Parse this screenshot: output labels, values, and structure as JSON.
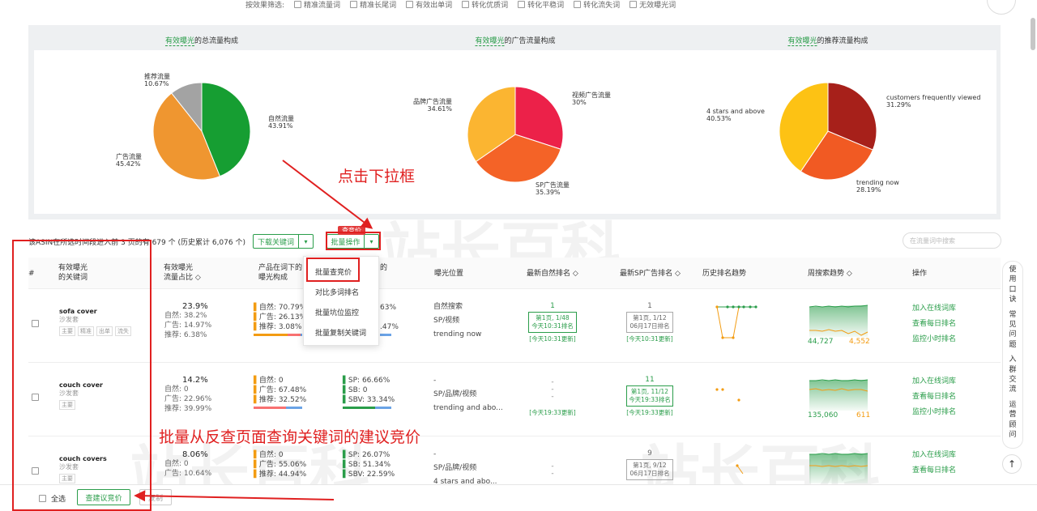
{
  "filters": {
    "prefix": "按效果筛选:",
    "options": [
      "精准流量词",
      "精准长尾词",
      "有效出单词",
      "转化优质词",
      "转化平稳词",
      "转化流失词",
      "无效曝光词"
    ]
  },
  "charts": [
    {
      "title_hl": "有效曝光",
      "title_rest": "的总流量构成",
      "slices": [
        {
          "label": "自然流量",
          "pct": "43.91%",
          "value": 43.91,
          "color": "#169e32"
        },
        {
          "label": "广告流量",
          "pct": "45.42%",
          "value": 45.42,
          "color": "#ef9630"
        },
        {
          "label": "推荐流量",
          "pct": "10.67%",
          "value": 10.67,
          "color": "#a3a3a3"
        }
      ]
    },
    {
      "title_hl": "有效曝光",
      "title_rest": "的广告流量构成",
      "slices": [
        {
          "label": "视频广告流量",
          "pct": "30%",
          "value": 30,
          "color": "#ec2149"
        },
        {
          "label": "SP广告流量",
          "pct": "35.39%",
          "value": 35.39,
          "color": "#f46327"
        },
        {
          "label": "品牌广告流量",
          "pct": "34.61%",
          "value": 34.61,
          "color": "#fbb531"
        }
      ]
    },
    {
      "title_hl": "有效曝光",
      "title_rest": "的推荐流量构成",
      "slices": [
        {
          "label": "customers frequently viewed",
          "pct": "31.29%",
          "value": 31.29,
          "color": "#a7201a"
        },
        {
          "label": "trending now",
          "pct": "28.19%",
          "value": 28.19,
          "color": "#f15a23"
        },
        {
          "label": "4 stars and above",
          "pct": "40.53%",
          "value": 40.53,
          "color": "#fdc214"
        }
      ]
    }
  ],
  "annotations": {
    "click_dropdown": "点击下拉框",
    "batch_query": "批量从反查页面查询关键词的建议竞价",
    "bid_badge": "查竞价"
  },
  "toolbar": {
    "summary": "该ASIN在所选时间段进入前 3 页的有 679 个 (历史累计 6,076 个)",
    "download_btn": "下载关键词",
    "batch_btn": "批量操作",
    "caret": "▾",
    "search_placeholder": "在流量词中搜索"
  },
  "dropdown": {
    "items": [
      "批量查竞价",
      "对比多词排名",
      "批量坑位监控",
      "批量复制关键词"
    ]
  },
  "table": {
    "headers": {
      "hash": "#",
      "keyword_1": "有效曝光",
      "keyword_2": "的关键词",
      "share_1": "有效曝光",
      "share_2": "流量占比 ◇",
      "mix_1": "产品在词下的",
      "mix_2": "曝光构成",
      "mix_right": "的",
      "position": "曝光位置",
      "natural_rank": "最新自然排名 ◇",
      "sp_rank": "最新SP广告排名 ◇",
      "history": "历史排名趋势",
      "weekly": "周搜索趋势 ◇",
      "ops": "操作"
    },
    "rows": [
      {
        "keyword": "sofa cover",
        "category": "沙发套",
        "tags": [
          "主要",
          "精准",
          "出单",
          "流失"
        ],
        "share": "23.9%",
        "natural": "自然: 38.2%",
        "ad": "广告: 14.97%",
        "rec": "推荐: 6.38%",
        "mix_natural": "自然: 70.79%",
        "mix_ad": "广告: 26.13%",
        "mix_rec": "推荐: 3.08%",
        "ad_sp": "63%",
        "ad_sb": "",
        "ad_sbv": ".47%",
        "positions": [
          "自然搜索",
          "SP/视频",
          "trending now"
        ],
        "nat_rank_num": "1",
        "nat_rank_box_1": "第1页, 1/48",
        "nat_rank_box_2": "今天10:31排名",
        "nat_rank_upd": "[今天10:31更新]",
        "sp_rank_num": "1",
        "sp_rank_box_1": "第1页, 1/12",
        "sp_rank_box_2": "06月17日排名",
        "sp_rank_upd": "[今天10:31更新]",
        "trend_left": "44,727",
        "trend_right": "4,552",
        "ops": [
          "加入在线词库",
          "查看每日排名",
          "监控小时排名"
        ]
      },
      {
        "keyword": "couch cover",
        "category": "沙发套",
        "tags": [
          "主要"
        ],
        "share": "14.2%",
        "natural": "自然: 0",
        "ad": "广告: 22.96%",
        "rec": "推荐: 39.99%",
        "mix_natural": "自然: 0",
        "mix_ad": "广告: 67.48%",
        "mix_rec": "推荐: 32.52%",
        "ad_sp": "SP: 66.66%",
        "ad_sb": "SB: 0",
        "ad_sbv": "SBV: 33.34%",
        "positions": [
          "-",
          "SP/品牌/视频",
          "trending and abo..."
        ],
        "nat_rank_num": "-",
        "nat_rank_upd": "[今天19:33更新]",
        "sp_rank_num": "11",
        "sp_rank_box_1": "第1页, 11/12",
        "sp_rank_box_2": "今天19:33排名",
        "sp_rank_upd": "[今天19:33更新]",
        "trend_left": "135,060",
        "trend_right": "611",
        "ops": [
          "加入在线词库",
          "查看每日排名",
          "监控小时排名"
        ]
      },
      {
        "keyword": "couch covers",
        "category": "沙发套",
        "tags": [
          "主要"
        ],
        "share": "8.06%",
        "natural": "自然: 0",
        "ad": "广告: 10.64%",
        "rec": "",
        "mix_natural": "自然: 0",
        "mix_ad": "广告: 55.06%",
        "mix_rec": "推荐: 44.94%",
        "ad_sp": "SP: 26.07%",
        "ad_sb": "SB: 51.34%",
        "ad_sbv": "SBV: 22.59%",
        "positions": [
          "-",
          "SP/品牌/视频",
          "4 stars and abo..."
        ],
        "nat_rank_num": "-",
        "sp_rank_num": "9",
        "sp_rank_box_1": "第1页, 9/12",
        "sp_rank_box_2": "06月17日排名",
        "ops": [
          "加入在线词库",
          "查看每日排名"
        ]
      }
    ]
  },
  "side_bar": [
    "使用口诀",
    "常见问题",
    "入群交流",
    "运营顾问"
  ],
  "bottom": {
    "select_all": "全选",
    "query_bid": "查建议竞价",
    "other_btn": "复制"
  },
  "watermark": "站长百科"
}
